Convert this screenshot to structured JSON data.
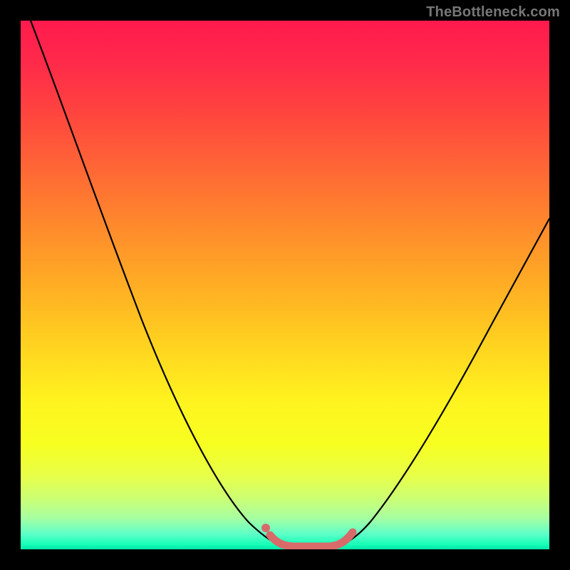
{
  "watermark": "TheBottleneck.com",
  "chart_data": {
    "type": "line",
    "title": "",
    "xlabel": "",
    "ylabel": "",
    "xlim": [
      0,
      100
    ],
    "ylim": [
      0,
      100
    ],
    "grid": false,
    "legend": false,
    "series": [
      {
        "name": "bottleneck-curve",
        "color": "#000000",
        "x": [
          2,
          10,
          18,
          26,
          34,
          40,
          44,
          48,
          52,
          56,
          60,
          64,
          70,
          78,
          86,
          94,
          100
        ],
        "values": [
          100,
          80,
          60,
          40,
          22,
          10,
          4,
          1,
          0,
          0,
          1,
          4,
          10,
          22,
          36,
          50,
          60
        ]
      },
      {
        "name": "bottom-marker",
        "color": "#d86a6a",
        "x": [
          47,
          49,
          51,
          53,
          55,
          57,
          59,
          61
        ],
        "values": [
          2,
          1,
          0.5,
          0.5,
          0.5,
          0.5,
          1,
          3
        ]
      }
    ],
    "annotations": [
      {
        "name": "marker-dot",
        "x": 46,
        "y": 4
      }
    ]
  },
  "colors": {
    "background": "#000000",
    "curve": "#000000",
    "marker": "#d86a6a",
    "watermark": "#777777"
  }
}
